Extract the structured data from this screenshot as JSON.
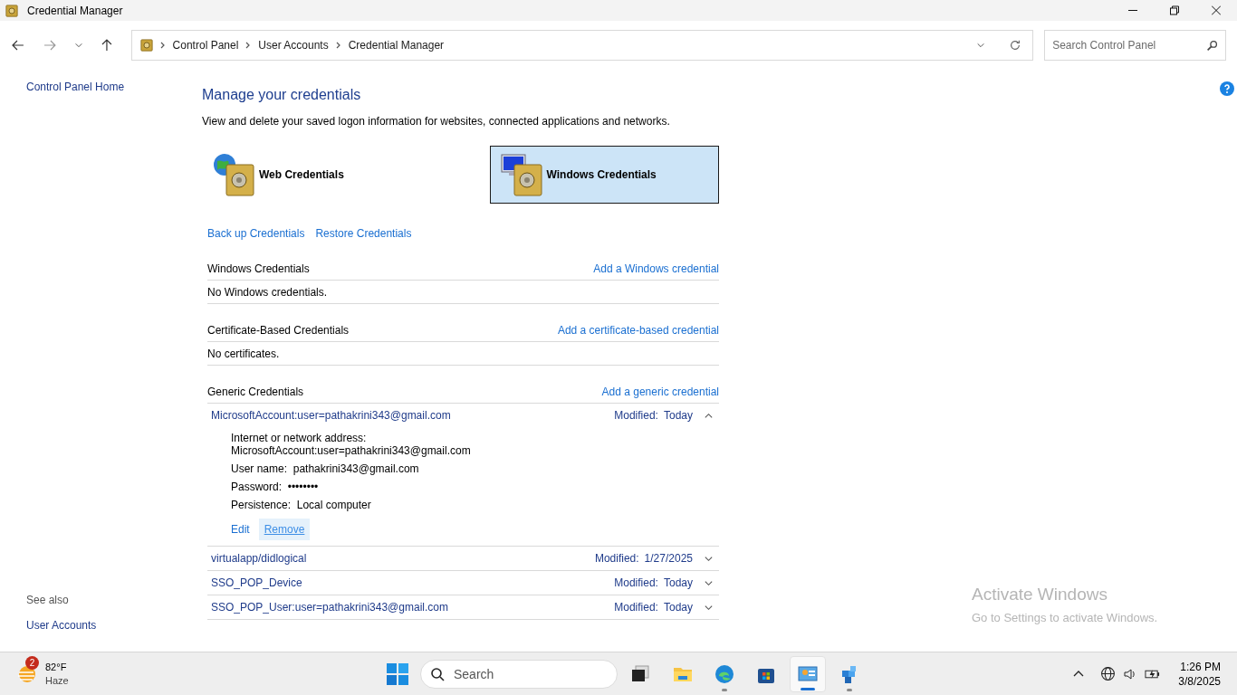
{
  "window": {
    "title": "Credential Manager"
  },
  "nav": {
    "breadcrumb": [
      "Control Panel",
      "User Accounts",
      "Credential Manager"
    ],
    "search_placeholder": "Search Control Panel"
  },
  "sidebar": {
    "home": "Control Panel Home",
    "see_also": "See also",
    "links": [
      "User Accounts"
    ]
  },
  "main": {
    "heading": "Manage your credentials",
    "description": "View and delete your saved logon information for websites, connected applications and networks.",
    "credential_types": [
      {
        "kind": "web",
        "label": "Web Credentials",
        "selected": false
      },
      {
        "kind": "windows",
        "label": "Windows Credentials",
        "selected": true
      }
    ],
    "actions": [
      "Back up Credentials",
      "Restore Credentials"
    ],
    "sections": [
      {
        "title": "Windows Credentials",
        "action": "Add a Windows credential",
        "empty_text": "No Windows credentials."
      },
      {
        "title": "Certificate-Based Credentials",
        "action": "Add a certificate-based credential",
        "empty_text": "No certificates."
      },
      {
        "title": "Generic Credentials",
        "action": "Add a generic credential",
        "items": [
          {
            "name": "MicrosoftAccount:user=pathakrini343@gmail.com",
            "modified_label": "Modified:",
            "modified": "Today",
            "expanded": true,
            "details": [
              {
                "kind": "block",
                "label": "Internet or network address:",
                "value": "MicrosoftAccount:user=pathakrini343@gmail.com"
              },
              {
                "kind": "inline",
                "label": "User name:",
                "value": "pathakrini343@gmail.com"
              },
              {
                "kind": "inline",
                "label": "Password:",
                "value": "••••••••"
              },
              {
                "kind": "inline",
                "label": "Persistence:",
                "value": "Local computer"
              }
            ],
            "actions": [
              {
                "label": "Edit",
                "highlighted": false
              },
              {
                "label": "Remove",
                "highlighted": true
              }
            ]
          },
          {
            "name": "virtualapp/didlogical",
            "modified_label": "Modified:",
            "modified": "1/27/2025",
            "expanded": false
          },
          {
            "name": "SSO_POP_Device",
            "modified_label": "Modified:",
            "modified": "Today",
            "expanded": false
          },
          {
            "name": "SSO_POP_User:user=pathakrini343@gmail.com",
            "modified_label": "Modified:",
            "modified": "Today",
            "expanded": false
          }
        ]
      }
    ]
  },
  "activation": {
    "title": "Activate Windows",
    "subtitle": "Go to Settings to activate Windows."
  },
  "taskbar": {
    "weather": {
      "badge": "2",
      "temperature": "82°F",
      "condition": "Haze"
    },
    "search_placeholder": "Search",
    "apps": [
      {
        "kind": "taskview",
        "running": false,
        "selected": false
      },
      {
        "kind": "explorer",
        "running": false,
        "selected": false
      },
      {
        "kind": "edge",
        "running": true,
        "selected": false
      },
      {
        "kind": "store",
        "running": false,
        "selected": false
      },
      {
        "kind": "controlpanel",
        "running": true,
        "selected": true
      },
      {
        "kind": "cubes",
        "running": true,
        "selected": false
      }
    ],
    "time": "1:26 PM",
    "date": "3/8/2025"
  }
}
